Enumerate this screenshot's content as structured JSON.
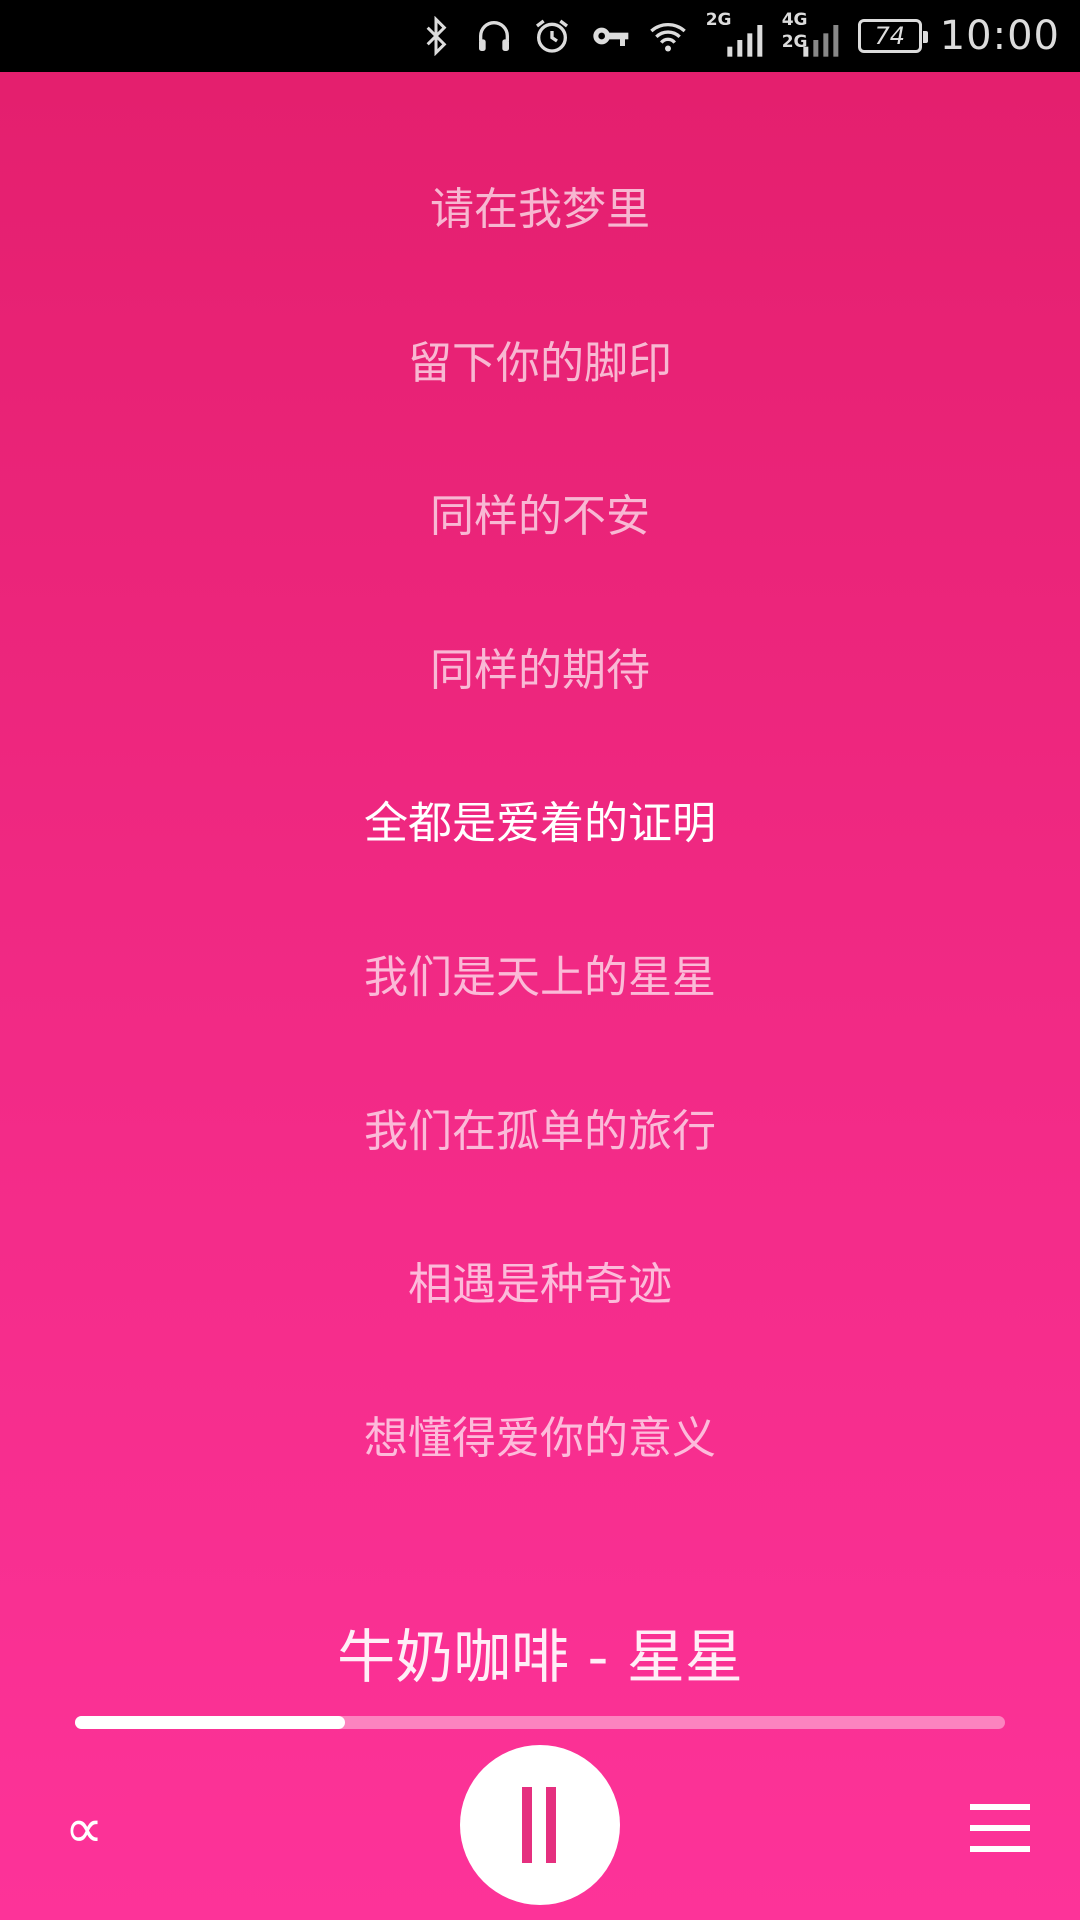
{
  "status_bar": {
    "time": "10:00",
    "battery": "74",
    "network_1": "2G",
    "network_2_top": "4G",
    "network_2_bottom": "2G",
    "icons": [
      "bluetooth-icon",
      "headphones-icon",
      "alarm-icon",
      "vpn-key-icon",
      "wifi-icon",
      "signal-icon",
      "signal-icon",
      "battery-icon"
    ]
  },
  "lyrics": {
    "lines": [
      "请在我梦里",
      "留下你的脚印",
      "同样的不安",
      "同样的期待",
      "全都是爱着的证明",
      "我们是天上的星星",
      "我们在孤单的旅行",
      "相遇是种奇迹",
      "想懂得爱你的意义"
    ],
    "active_index": 4
  },
  "player": {
    "song_title": "牛奶咖啡 - 星星",
    "progress": 0.29,
    "mode_icon": "shuffle-mode-icon",
    "play_icon": "pause-icon",
    "menu_icon": "menu-icon"
  },
  "colors": {
    "background_top": "#e31e6c",
    "background_bottom": "#fd3399",
    "accent": "#e5307f"
  }
}
